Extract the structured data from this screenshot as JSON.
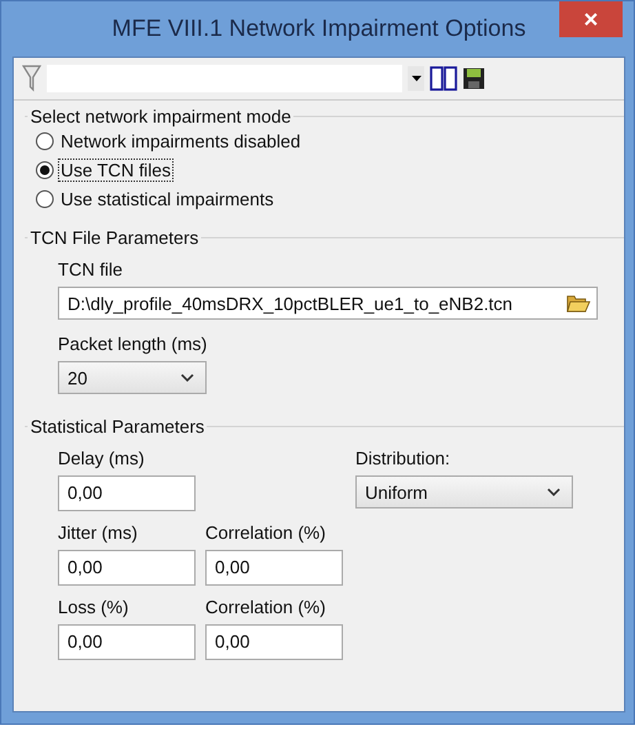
{
  "window": {
    "title": "MFE VIII.1 Network Impairment Options",
    "close": "×"
  },
  "mode_group": {
    "title": "Select network impairment mode",
    "options": [
      {
        "label": "Network impairments disabled",
        "selected": false,
        "focused": false
      },
      {
        "label": "Use TCN files",
        "selected": true,
        "focused": true
      },
      {
        "label": "Use statistical impairments",
        "selected": false,
        "focused": false
      }
    ]
  },
  "tcn_group": {
    "title": "TCN File Parameters",
    "file_label": "TCN file",
    "file_value": "D:\\dly_profile_40msDRX_10pctBLER_ue1_to_eNB2.tcn",
    "packet_label": "Packet length (ms)",
    "packet_value": "20"
  },
  "stat_group": {
    "title": "Statistical Parameters",
    "delay": {
      "label": "Delay (ms)",
      "value": "0,00"
    },
    "distribution": {
      "label": "Distribution:",
      "value": "Uniform"
    },
    "jitter": {
      "label": "Jitter (ms)",
      "value": "0,00"
    },
    "jitter_correlation": {
      "label": "Correlation (%)",
      "value": "0,00"
    },
    "loss": {
      "label": "Loss (%)",
      "value": "0,00"
    },
    "loss_correlation": {
      "label": "Correlation (%)",
      "value": "0,00"
    }
  }
}
